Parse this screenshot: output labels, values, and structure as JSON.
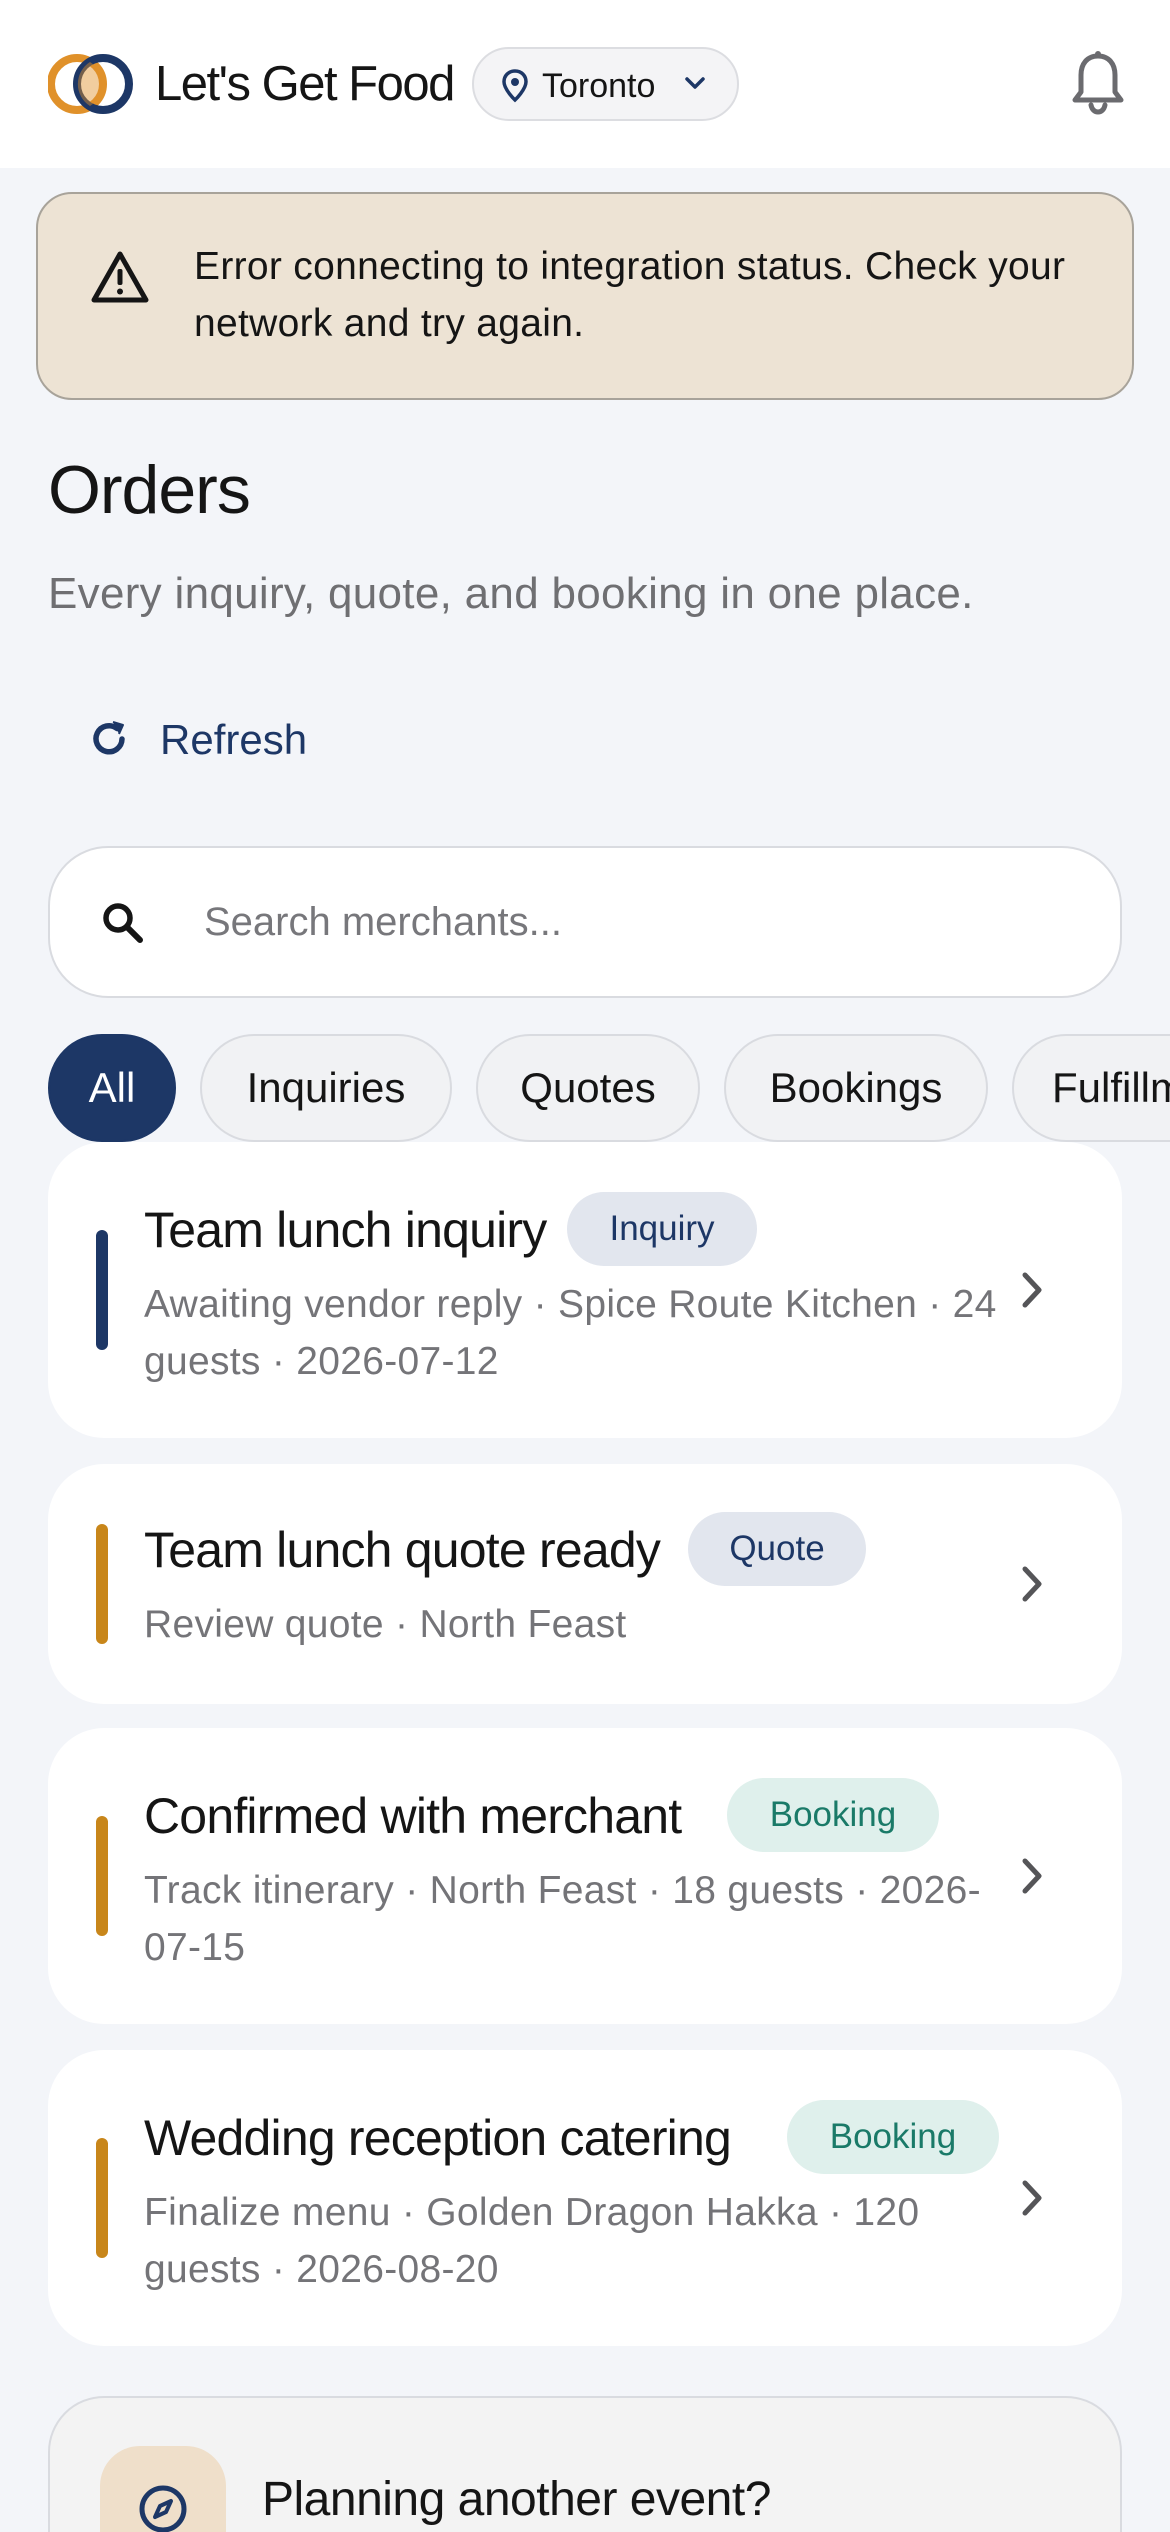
{
  "header": {
    "app_name": "Let's Get Food",
    "city": "Toronto"
  },
  "banner": {
    "message": "Error connecting to integration status. Check your network and try again."
  },
  "page": {
    "title": "Orders",
    "subtitle": "Every inquiry, quote, and booking in one place.",
    "refresh_label": "Refresh"
  },
  "search": {
    "placeholder": "Search merchants..."
  },
  "filters": [
    "All",
    "Inquiries",
    "Quotes",
    "Bookings",
    "Fulfillment"
  ],
  "orders": [
    {
      "title": "Team lunch inquiry",
      "badge": "Inquiry",
      "meta": "Awaiting vendor reply · Spice Route Kitchen · 24 guests · 2026-07-12"
    },
    {
      "title": "Team lunch quote ready",
      "badge": "Quote",
      "meta": "Review quote · North Feast"
    },
    {
      "title": "Confirmed with merchant",
      "badge": "Booking",
      "meta": "Track itinerary · North Feast · 18 guests · 2026-07-15"
    },
    {
      "title": "Wedding reception catering",
      "badge": "Booking",
      "meta": "Finalize menu · Golden Dragon Hakka · 120 guests · 2026-08-20"
    }
  ],
  "promo": {
    "title": "Planning another event?"
  },
  "colors": {
    "brand_navy": "#1d3766",
    "accent_gold": "#c8861a",
    "booking_green": "#1a7a68",
    "banner_bg": "#ede3d4"
  }
}
